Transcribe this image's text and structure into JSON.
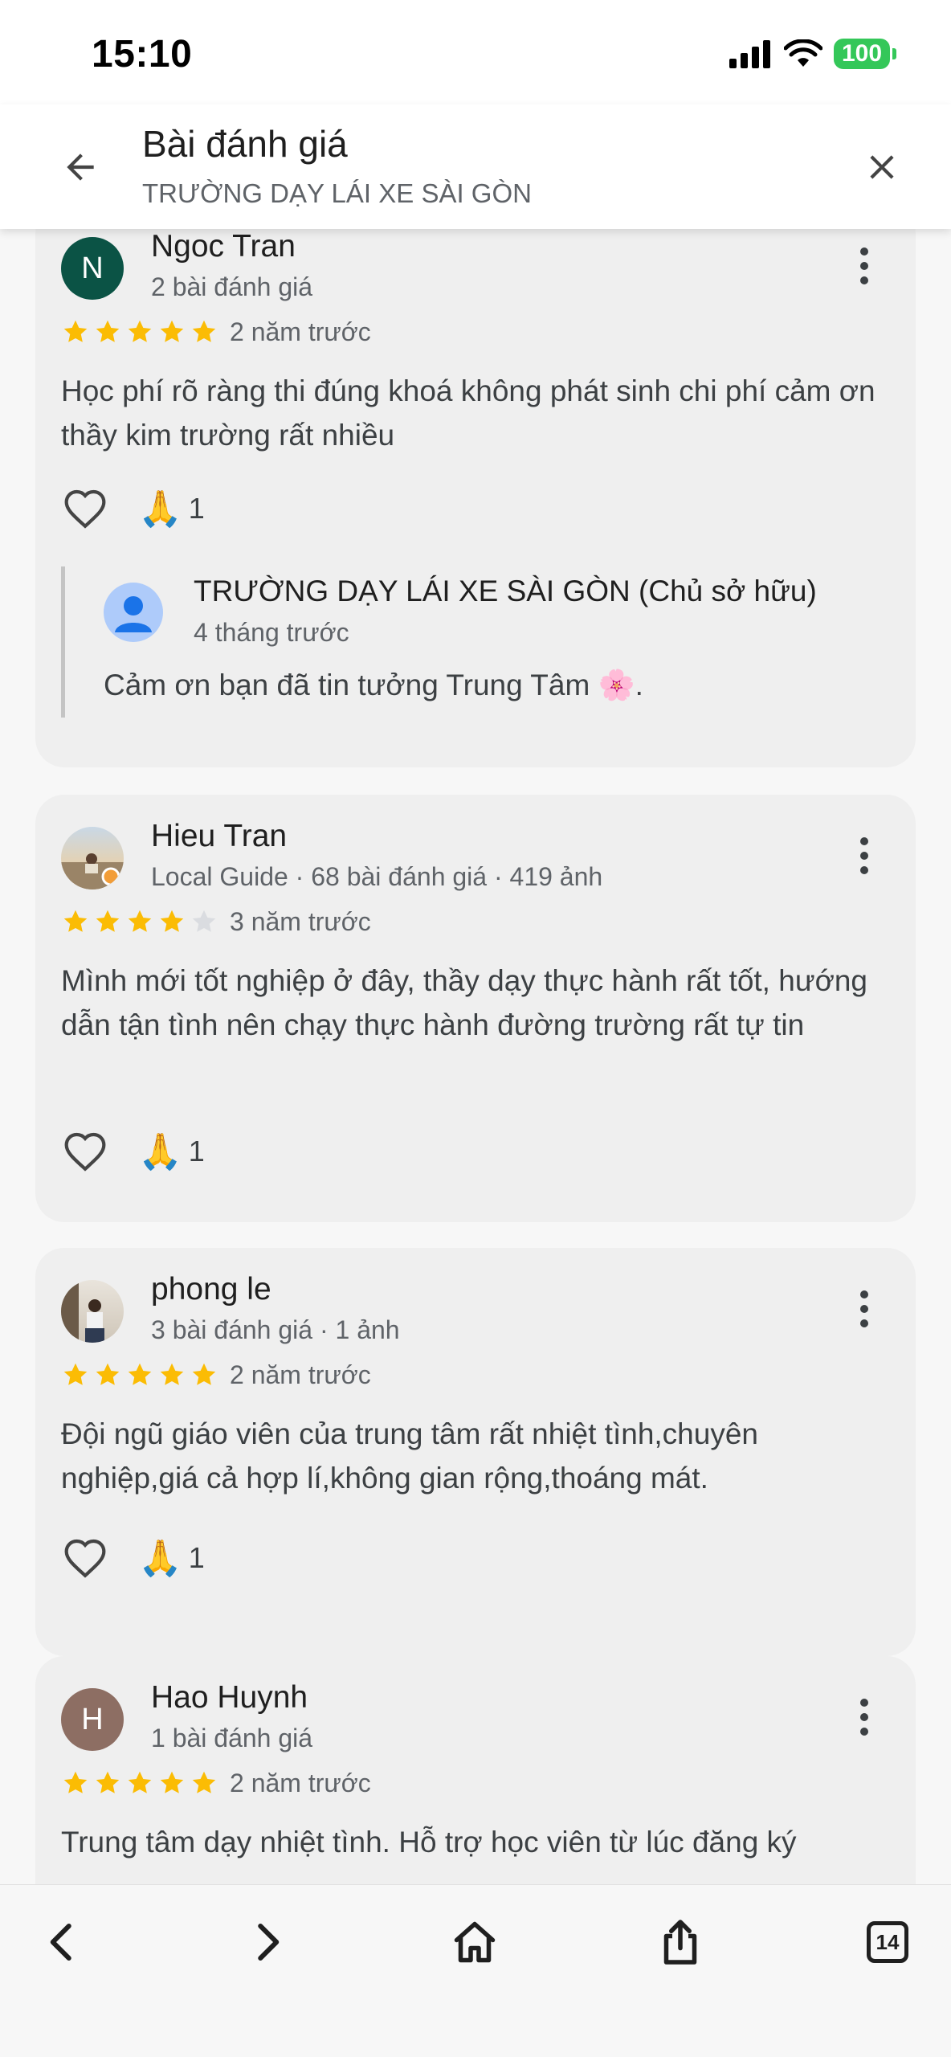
{
  "status": {
    "time": "15:10",
    "battery": "100"
  },
  "header": {
    "title": "Bài đánh giá",
    "subtitle": "TRƯỜNG DẠY LÁI XE SÀI GÒN"
  },
  "reviews": [
    {
      "avatar_letter": "N",
      "avatar_color": "#0b5345",
      "name": "Ngoc Tran",
      "meta": "2 bài đánh giá",
      "rating": 5,
      "time": "2 năm trước",
      "text": "Học phí rõ ràng thi đúng khoá không phát sinh chi phí cảm ơn thầy kim trường rất nhiều",
      "reaction_count": "1",
      "owner_reply": {
        "name": "TRƯỜNG DẠY LÁI XE SÀI GÒN (Chủ sở hữu)",
        "time": "4 tháng trước",
        "text": "Cảm ơn bạn đã tin tưởng Trung Tâm 🌸."
      }
    },
    {
      "avatar_letter": "",
      "name": "Hieu Tran",
      "meta": "Local Guide · 68 bài đánh giá · 419 ảnh",
      "rating": 4,
      "time": "3 năm trước",
      "text": "Mình mới tốt nghiệp ở đây, thầy dạy thực hành rất tốt, hướng dẫn tận tình nên chạy thực hành đường trường rất tự tin",
      "reaction_count": "1"
    },
    {
      "avatar_letter": "",
      "name": "phong le",
      "meta": "3 bài đánh giá · 1 ảnh",
      "rating": 5,
      "time": "2 năm trước",
      "text": "Đội ngũ giáo viên của trung tâm rất nhiệt tình,chuyên nghiệp,giá cả hợp lí,không gian rộng,thoáng mát.",
      "reaction_count": "1"
    },
    {
      "avatar_letter": "H",
      "avatar_color": "#8d6e63",
      "name": "Hao Huynh",
      "meta": "1 bài đánh giá",
      "rating": 5,
      "time": "2 năm trước",
      "text": "Trung tâm dạy nhiệt tình. Hỗ trợ học viên từ lúc đăng ký"
    }
  ],
  "icons": {
    "back": "arrow-left-icon",
    "close": "close-icon",
    "like": "heart-outline-icon",
    "reaction": "folded-hands-emoji",
    "more": "more-vertical-icon"
  },
  "colors": {
    "star": "#fbbc04",
    "star_empty": "#dadce0"
  },
  "browser": {
    "tabs_count": "14"
  }
}
